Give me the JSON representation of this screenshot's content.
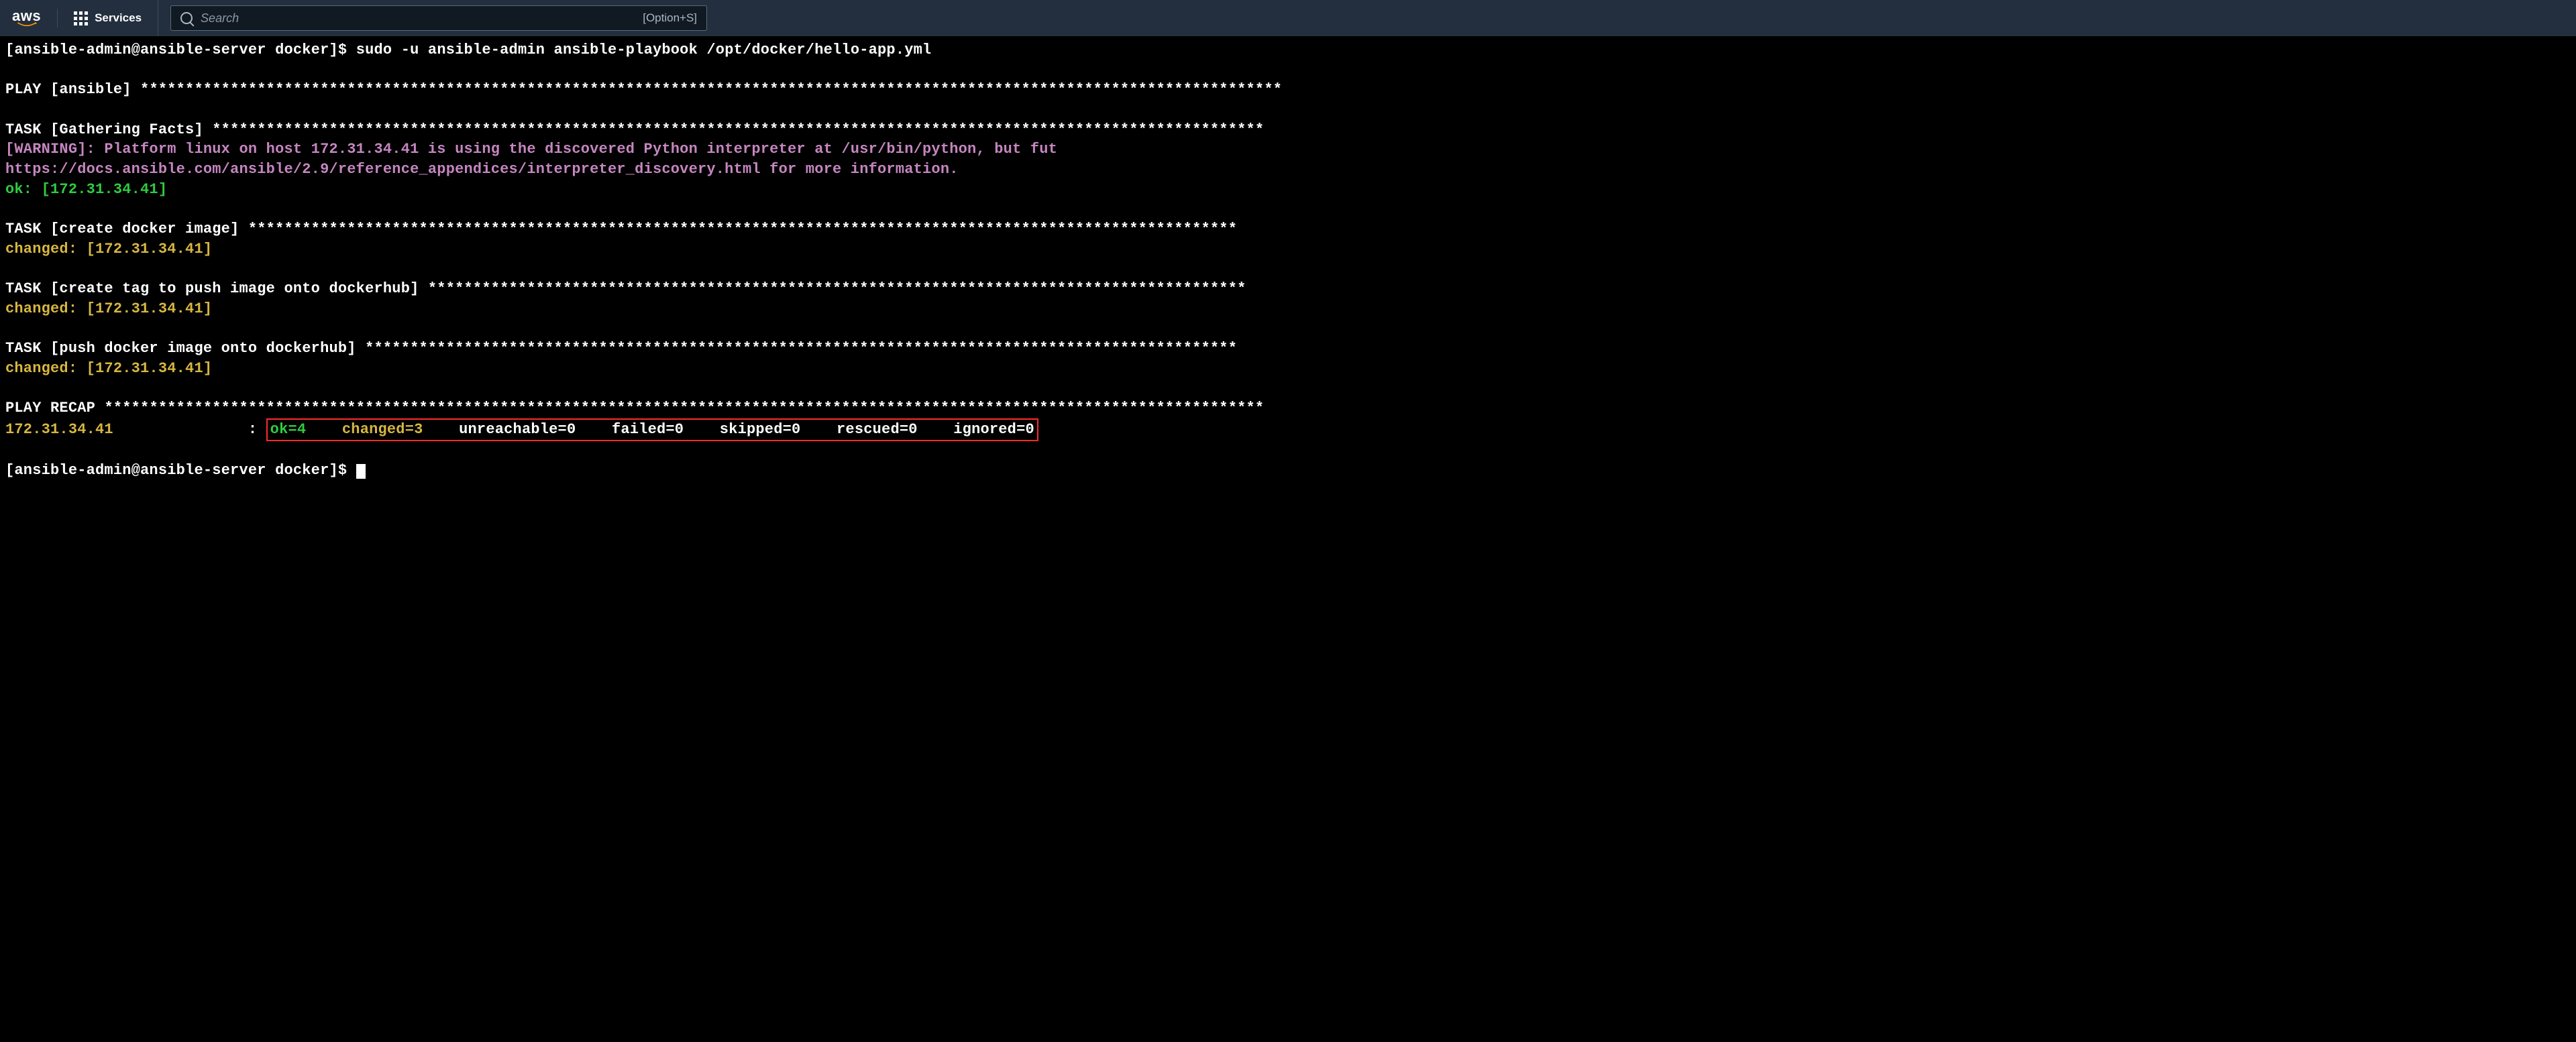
{
  "nav": {
    "logo": "aws",
    "services_label": "Services",
    "search_placeholder": "Search",
    "search_hint": "[Option+S]"
  },
  "terminal": {
    "prompt_user": "[ansible-admin@ansible-server docker]$",
    "command": "sudo -u ansible-admin ansible-playbook /opt/docker/hello-app.yml",
    "play_header": "PLAY [ansible] ",
    "task_gathering_header": "TASK [Gathering Facts] ",
    "warning_line1": "[WARNING]: Platform linux on host 172.31.34.41 is using the discovered Python interpreter at /usr/bin/python, but fut",
    "warning_line2": "https://docs.ansible.com/ansible/2.9/reference_appendices/interpreter_discovery.html for more information.",
    "ok_host": "ok: [172.31.34.41]",
    "task_create_image_header": "TASK [create docker image] ",
    "changed_host": "changed: [172.31.34.41]",
    "task_create_tag_header": "TASK [create tag to push image onto dockerhub] ",
    "task_push_image_header": "TASK [push docker image onto dockerhub] ",
    "play_recap_header": "PLAY RECAP ",
    "recap_host": "172.31.34.41",
    "recap": {
      "ok": "ok=4",
      "changed": "changed=3",
      "unreachable": "unreachable=0",
      "failed": "failed=0",
      "skipped": "skipped=0",
      "rescued": "rescued=0",
      "ignored": "ignored=0"
    },
    "stars_short": "*******************************************************************************************************************************",
    "stars_med": "*********************************************************************************************************************",
    "stars_long": "*******************************************************************************************************************************",
    "stars_recap": "*********************************************************************************************************************************",
    "stars_task2": "**************************************************************************************************************",
    "stars_task3": "*******************************************************************************************",
    "stars_task4": "*************************************************************************************************"
  }
}
